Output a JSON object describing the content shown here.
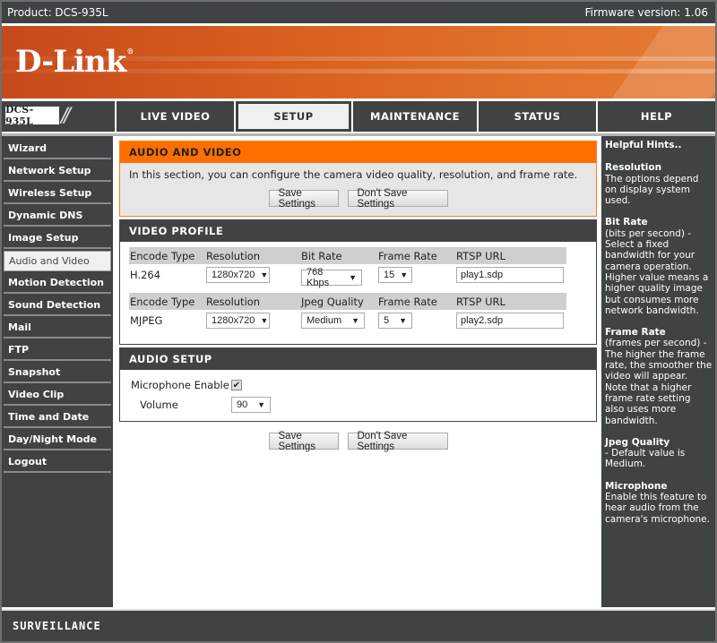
{
  "topbar": {
    "product": "Product: DCS-935L",
    "firmware": "Firmware version: 1.06"
  },
  "brand": {
    "logo": "D-Link",
    "model_badge": "DCS-935L",
    "accent_color": "#ff6f00"
  },
  "nav": {
    "tabs": [
      {
        "label": "LIVE VIDEO",
        "active": false
      },
      {
        "label": "SETUP",
        "active": true
      },
      {
        "label": "MAINTENANCE",
        "active": false
      },
      {
        "label": "STATUS",
        "active": false
      },
      {
        "label": "HELP",
        "active": false
      }
    ]
  },
  "sidebar": {
    "items": [
      {
        "label": "Wizard"
      },
      {
        "label": "Network Setup"
      },
      {
        "label": "Wireless Setup"
      },
      {
        "label": "Dynamic DNS"
      },
      {
        "label": "Image Setup"
      },
      {
        "label": "Audio and Video",
        "active": true
      },
      {
        "label": "Motion Detection"
      },
      {
        "label": "Sound Detection"
      },
      {
        "label": "Mail"
      },
      {
        "label": "FTP"
      },
      {
        "label": "Snapshot"
      },
      {
        "label": "Video Clip"
      },
      {
        "label": "Time and Date"
      },
      {
        "label": "Day/Night Mode"
      },
      {
        "label": "Logout"
      }
    ]
  },
  "audio_video": {
    "title": "AUDIO AND VIDEO",
    "description": "In this section, you can configure the camera video quality, resolution, and frame rate.",
    "save_label": "Save Settings",
    "dont_save_label": "Don't Save Settings"
  },
  "video_profile": {
    "title": "VIDEO PROFILE",
    "profiles": [
      {
        "headers": [
          "Encode Type",
          "Resolution",
          "Bit Rate",
          "Frame Rate",
          "RTSP URL"
        ],
        "encode_type": "H.264",
        "resolution": "1280x720",
        "bitrate_or_quality": "768 Kbps",
        "frame_rate": "15",
        "rtsp_url": "play1.sdp"
      },
      {
        "headers": [
          "Encode Type",
          "Resolution",
          "Jpeg Quality",
          "Frame Rate",
          "RTSP URL"
        ],
        "encode_type": "MJPEG",
        "resolution": "1280x720",
        "bitrate_or_quality": "Medium",
        "frame_rate": "5",
        "rtsp_url": "play2.sdp"
      }
    ]
  },
  "audio_setup": {
    "title": "AUDIO SETUP",
    "mic_label": "Microphone Enable",
    "mic_enabled": true,
    "check_glyph": "✔",
    "volume_label": "Volume",
    "volume_value": "90"
  },
  "bottom": {
    "save_label": "Save Settings",
    "dont_save_label": "Don't Save Settings"
  },
  "icons": {
    "dropdown_arrow": "▼"
  },
  "hints": {
    "heading": "Helpful Hints..",
    "items": [
      {
        "title": "Resolution",
        "text": "The options depend on display system used."
      },
      {
        "title": "Bit Rate",
        "text": "(bits per second) - Select a fixed bandwidth for your camera operation. Higher value means a higher quality image but consumes more network bandwidth."
      },
      {
        "title": "Frame Rate",
        "text": "(frames per second) - The higher the frame rate, the smoother the video will appear. Note that a higher frame rate setting also uses more bandwidth."
      },
      {
        "title": "Jpeg Quality",
        "text": "- Default value is Medium."
      },
      {
        "title": "Microphone",
        "text": "Enable this feature to hear audio from the camera's microphone."
      }
    ]
  },
  "footer": {
    "label": "SURVEILLANCE"
  }
}
